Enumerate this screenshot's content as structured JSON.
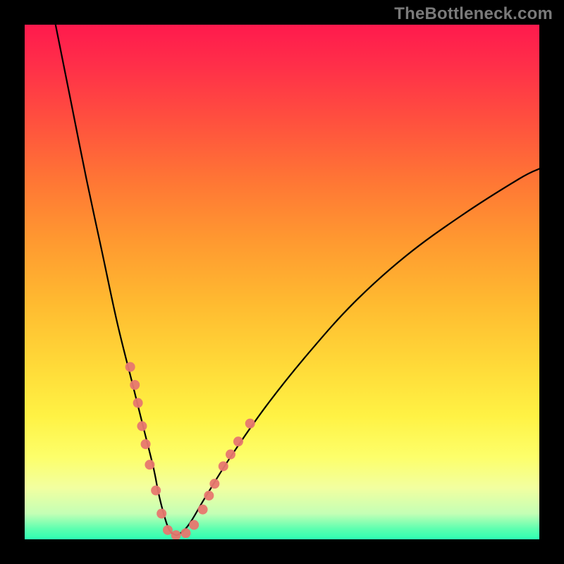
{
  "watermark": "TheBottleneck.com",
  "chart_data": {
    "type": "line",
    "title": "",
    "xlabel": "",
    "ylabel": "",
    "xlim": [
      0,
      100
    ],
    "ylim": [
      0,
      100
    ],
    "grid": false,
    "legend": false,
    "background_gradient": [
      "#ff1a4d",
      "#ff9930",
      "#fff244",
      "#2dffb2"
    ],
    "series": [
      {
        "name": "bottleneck-curve",
        "color": "#000000",
        "x": [
          6,
          9,
          12,
          15,
          18,
          21,
          23,
          25,
          26,
          27,
          28,
          29,
          30,
          32,
          35,
          40,
          47,
          55,
          64,
          74,
          85,
          96,
          100
        ],
        "y": [
          100,
          85,
          70,
          56,
          42,
          30,
          22,
          14,
          9,
          5,
          2,
          1,
          1,
          3,
          8,
          16,
          26,
          36,
          46,
          55,
          63,
          70,
          72
        ]
      }
    ],
    "markers": {
      "color": "#e7776f",
      "radius": 7,
      "points": [
        {
          "x": 20.5,
          "y": 33.5
        },
        {
          "x": 21.4,
          "y": 30.0
        },
        {
          "x": 22.0,
          "y": 26.5
        },
        {
          "x": 22.8,
          "y": 22.0
        },
        {
          "x": 23.5,
          "y": 18.5
        },
        {
          "x": 24.3,
          "y": 14.5
        },
        {
          "x": 25.5,
          "y": 9.5
        },
        {
          "x": 26.6,
          "y": 5.0
        },
        {
          "x": 27.8,
          "y": 1.8
        },
        {
          "x": 29.4,
          "y": 0.8
        },
        {
          "x": 31.3,
          "y": 1.2
        },
        {
          "x": 32.9,
          "y": 2.8
        },
        {
          "x": 34.6,
          "y": 5.8
        },
        {
          "x": 35.8,
          "y": 8.5
        },
        {
          "x": 36.9,
          "y": 10.8
        },
        {
          "x": 38.6,
          "y": 14.2
        },
        {
          "x": 40.0,
          "y": 16.5
        },
        {
          "x": 41.5,
          "y": 19.0
        },
        {
          "x": 43.8,
          "y": 22.5
        }
      ]
    }
  }
}
